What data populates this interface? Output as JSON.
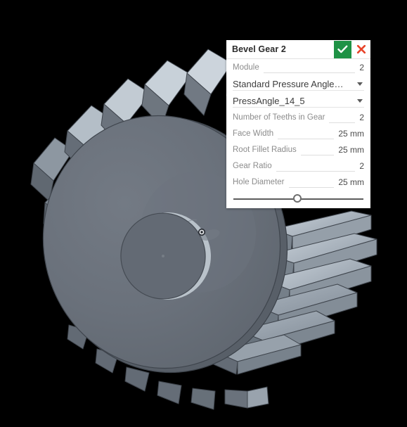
{
  "viewport": {
    "background_color": "#000000",
    "model_name": "bevel-gear",
    "body_color": "#666d77",
    "tooth_light_color": "#c3cbd3",
    "tooth_mid_color": "#9aa4ae",
    "tooth_dark_color": "#5a626c",
    "edge_color": "#3a4048",
    "origin_marker": "origin-point-icon"
  },
  "dialog": {
    "title": "Bevel Gear 2",
    "ok_icon": "check-icon",
    "ok_label": "OK",
    "cancel_icon": "close-icon",
    "cancel_label": "Cancel",
    "accent_ok_color": "#1e9245",
    "accent_cancel_color": "#e8442a",
    "fields": [
      {
        "label": "Module",
        "value": "2",
        "type": "number"
      },
      {
        "label": "Number of Teeths in Gear",
        "value": "2",
        "type": "number"
      },
      {
        "label": "Face Width",
        "value": "25 mm",
        "type": "length"
      },
      {
        "label": "Root Fillet Radius",
        "value": "25 mm",
        "type": "length"
      },
      {
        "label": "Gear Ratio",
        "value": "2",
        "type": "number"
      },
      {
        "label": "Hole Diameter",
        "value": "25 mm",
        "type": "length"
      }
    ],
    "dropdowns": [
      {
        "value": "Standard Pressure Angle…",
        "caret": "chevron-down-icon"
      },
      {
        "value": "PressAngle_14_5",
        "caret": "chevron-down-icon"
      }
    ],
    "slider": {
      "position_percent": 49,
      "min": 0,
      "max": 100
    }
  }
}
